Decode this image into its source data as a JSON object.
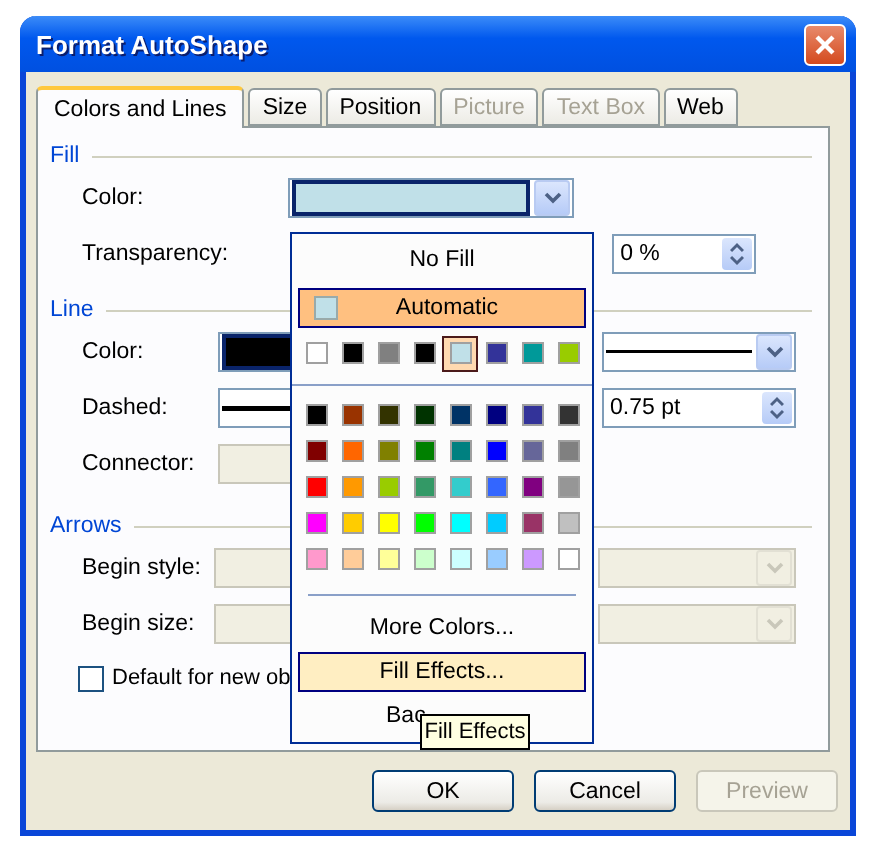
{
  "window": {
    "title": "Format AutoShape"
  },
  "tabs": [
    {
      "label": "Colors and Lines",
      "selected": true,
      "disabled": false
    },
    {
      "label": "Size",
      "selected": false,
      "disabled": false
    },
    {
      "label": "Position",
      "selected": false,
      "disabled": false
    },
    {
      "label": "Picture",
      "selected": false,
      "disabled": true
    },
    {
      "label": "Text Box",
      "selected": false,
      "disabled": true
    },
    {
      "label": "Web",
      "selected": false,
      "disabled": false
    }
  ],
  "fill": {
    "heading": "Fill",
    "color_label": "Color:",
    "transparency_label": "Transparency:",
    "transparency_value": "0 %"
  },
  "line": {
    "heading": "Line",
    "color_label": "Color:",
    "dashed_label": "Dashed:",
    "connector_label": "Connector:",
    "weight_value": "0.75 pt"
  },
  "arrows": {
    "heading": "Arrows",
    "begin_style_label": "Begin style:",
    "begin_size_label": "Begin size:"
  },
  "default_checkbox": {
    "label": "Default for new ob",
    "checked": false
  },
  "color_menu": {
    "no_fill": "No Fill",
    "automatic": {
      "label": "Automatic",
      "selected": true
    },
    "recent_colors": [
      {
        "color": "#ffffff",
        "selected": false
      },
      {
        "color": "#000000",
        "selected": false
      },
      {
        "color": "#808080",
        "selected": false
      },
      {
        "color": "#000000",
        "selected": false
      },
      {
        "color": "#c0e0e8",
        "selected": true
      },
      {
        "color": "#333399",
        "selected": false
      },
      {
        "color": "#009999",
        "selected": false
      },
      {
        "color": "#99cc00",
        "selected": false
      }
    ],
    "palette": [
      {
        "color": "#000000"
      },
      {
        "color": "#993300"
      },
      {
        "color": "#333300"
      },
      {
        "color": "#003300"
      },
      {
        "color": "#003366"
      },
      {
        "color": "#000080"
      },
      {
        "color": "#333399"
      },
      {
        "color": "#333333"
      },
      {
        "color": "#800000"
      },
      {
        "color": "#ff6600"
      },
      {
        "color": "#808000"
      },
      {
        "color": "#008000"
      },
      {
        "color": "#008080"
      },
      {
        "color": "#0000ff"
      },
      {
        "color": "#666699"
      },
      {
        "color": "#808080"
      },
      {
        "color": "#ff0000"
      },
      {
        "color": "#ff9900"
      },
      {
        "color": "#99cc00"
      },
      {
        "color": "#339966"
      },
      {
        "color": "#33cccc"
      },
      {
        "color": "#3366ff"
      },
      {
        "color": "#800080"
      },
      {
        "color": "#969696"
      },
      {
        "color": "#ff00ff"
      },
      {
        "color": "#ffcc00"
      },
      {
        "color": "#ffff00"
      },
      {
        "color": "#00ff00"
      },
      {
        "color": "#00ffff"
      },
      {
        "color": "#00ccff"
      },
      {
        "color": "#993366"
      },
      {
        "color": "#c0c0c0"
      },
      {
        "color": "#ff99cc"
      },
      {
        "color": "#ffcc99"
      },
      {
        "color": "#ffff99"
      },
      {
        "color": "#ccffcc"
      },
      {
        "color": "#ccffff"
      },
      {
        "color": "#99ccff"
      },
      {
        "color": "#cc99ff"
      },
      {
        "color": "#ffffff"
      }
    ],
    "items": [
      {
        "label": "More Colors...",
        "hovered": false
      },
      {
        "label": "Fill Effects...",
        "hovered": true
      },
      {
        "label": "Bac",
        "hovered": false
      }
    ]
  },
  "tooltip": "Fill Effects",
  "buttons": [
    {
      "label": "OK",
      "disabled": false
    },
    {
      "label": "Cancel",
      "disabled": false
    },
    {
      "label": "Preview",
      "disabled": true
    }
  ]
}
